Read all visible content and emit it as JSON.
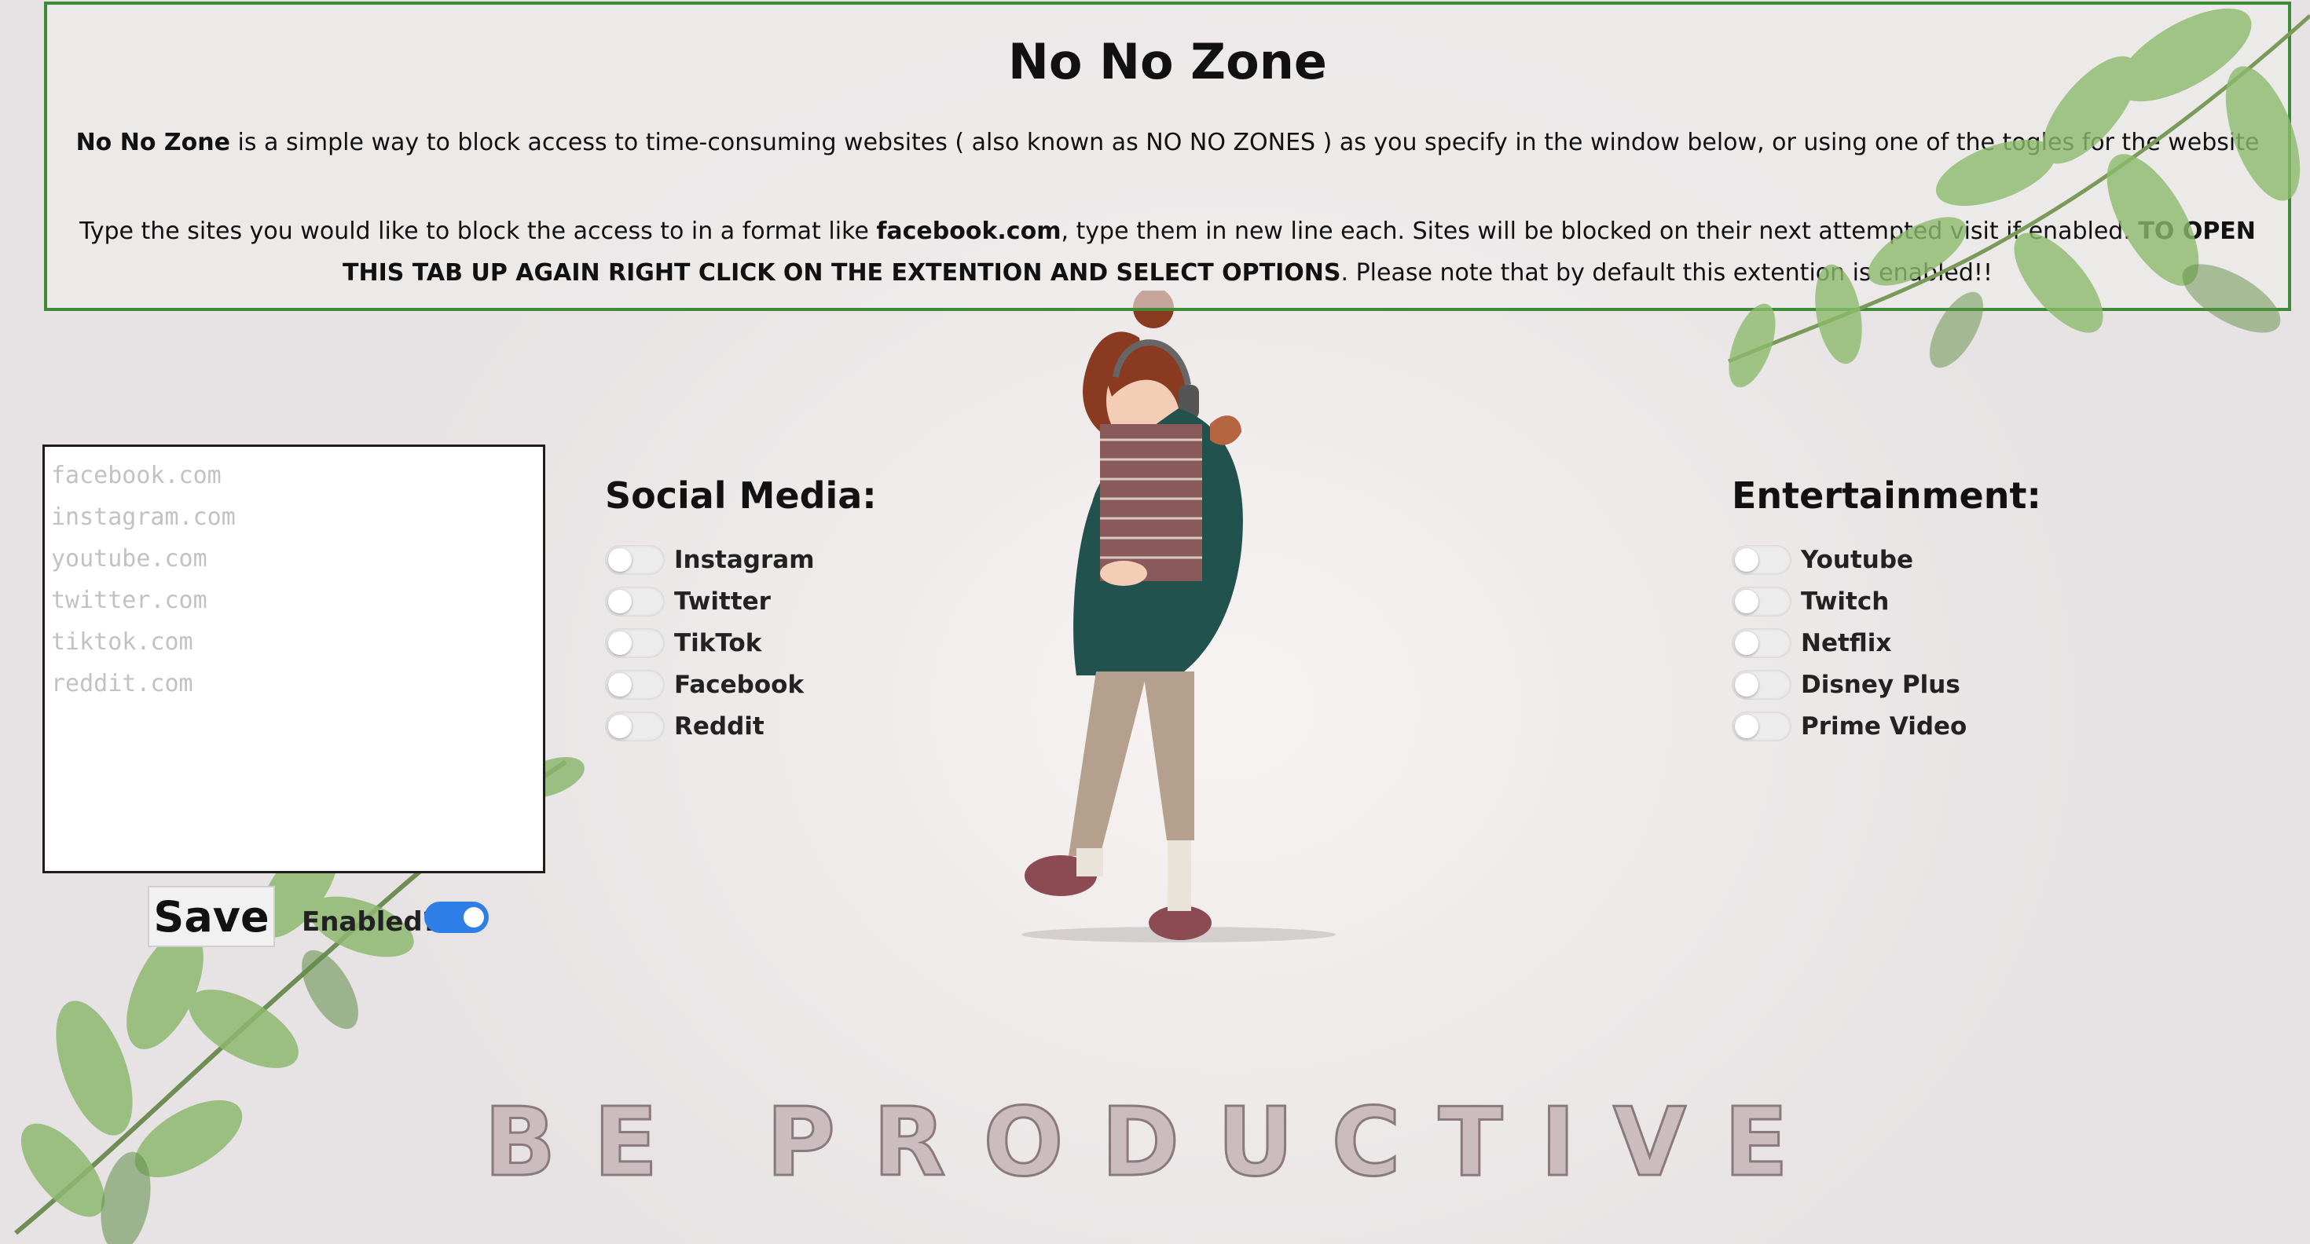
{
  "header": {
    "title": "No No Zone",
    "p1": {
      "name": "No No Zone",
      "text": " is a simple way to block access to time-consuming websites ( also known as NO NO ZONES ) as you specify in the window below, or using one of the togles for the website"
    },
    "p2": {
      "text1": "Type the sites you would like to block the access to in a format like ",
      "example": "facebook.com",
      "text2": ", type them in new line each. Sites will be blocked on their next attempted visit if enabled. ",
      "bold": "TO OPEN THIS TAB UP AGAIN RIGHT CLICK ON THE EXTENTION AND SELECT OPTIONS",
      "text3": ". Please note that by default this extention is enabled!!"
    }
  },
  "sites_input": {
    "placeholder": "facebook.com\ninstagram.com\nyoutube.com\ntwitter.com\ntiktok.com\nreddit.com"
  },
  "save_label": "Save",
  "enabled_label": "Enabled?",
  "enabled_state": true,
  "social": {
    "heading": "Social Media:",
    "items": [
      {
        "label": "Instagram",
        "on": false
      },
      {
        "label": "Twitter",
        "on": false
      },
      {
        "label": "TikTok",
        "on": false
      },
      {
        "label": "Facebook",
        "on": false
      },
      {
        "label": "Reddit",
        "on": false
      }
    ]
  },
  "entertainment": {
    "heading": "Entertainment:",
    "items": [
      {
        "label": "Youtube",
        "on": false
      },
      {
        "label": "Twitch",
        "on": false
      },
      {
        "label": "Netflix",
        "on": false
      },
      {
        "label": "Disney Plus",
        "on": false
      },
      {
        "label": "Prime Video",
        "on": false
      }
    ]
  },
  "slogan": "BE PRODUCTIVE",
  "colors": {
    "border": "#3e8a36",
    "toggle_on": "#2f7de6",
    "leaf": "#7fae5f"
  }
}
